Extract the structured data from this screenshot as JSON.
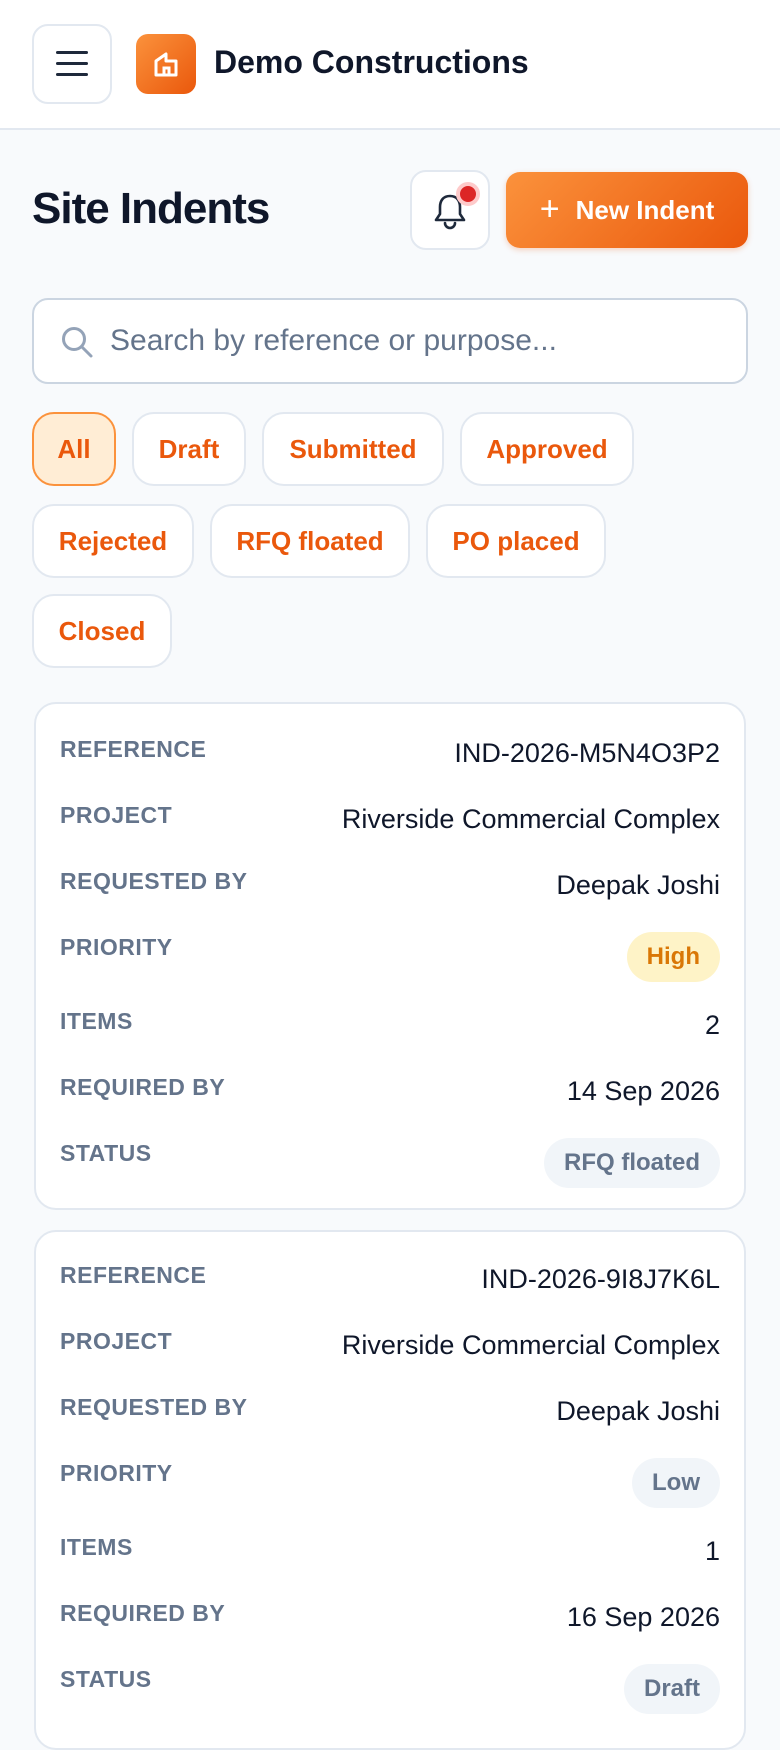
{
  "header": {
    "brand": "Demo Constructions"
  },
  "page": {
    "title": "Site Indents",
    "new_button_label": "New Indent"
  },
  "search": {
    "placeholder": "Search by reference or purpose...",
    "value": ""
  },
  "filters": [
    {
      "label": "All",
      "active": true
    },
    {
      "label": "Draft",
      "active": false
    },
    {
      "label": "Submitted",
      "active": false
    },
    {
      "label": "Approved",
      "active": false
    },
    {
      "label": "Rejected",
      "active": false
    },
    {
      "label": "RFQ floated",
      "active": false
    },
    {
      "label": "PO placed",
      "active": false
    },
    {
      "label": "Closed",
      "active": false
    }
  ],
  "field_labels": {
    "reference": "REFERENCE",
    "project": "PROJECT",
    "requested_by": "REQUESTED BY",
    "priority": "PRIORITY",
    "items": "ITEMS",
    "required_by": "REQUIRED BY",
    "status": "STATUS"
  },
  "indents": [
    {
      "reference": "IND-2026-M5N4O3P2",
      "project": "Riverside Commercial Complex",
      "requested_by": "Deepak Joshi",
      "priority": "High",
      "items": "2",
      "required_by": "14 Sep 2026",
      "status": "RFQ floated"
    },
    {
      "reference": "IND-2026-9I8J7K6L",
      "project": "Riverside Commercial Complex",
      "requested_by": "Deepak Joshi",
      "priority": "Low",
      "items": "1",
      "required_by": "16 Sep 2026",
      "status": "Draft"
    }
  ],
  "colors": {
    "accent": "#ea580c",
    "accent_light": "#fb923c",
    "priority_high_bg": "#fef3c7",
    "priority_high_text": "#d97706",
    "neutral_bg": "#f1f5f9",
    "neutral_text": "#64748b",
    "notification_dot": "#dc2626"
  },
  "icons": {
    "menu": "hamburger-menu-icon",
    "logo": "building-logo-icon",
    "notifications": "bell-icon",
    "new": "plus-icon",
    "search": "search-icon"
  }
}
